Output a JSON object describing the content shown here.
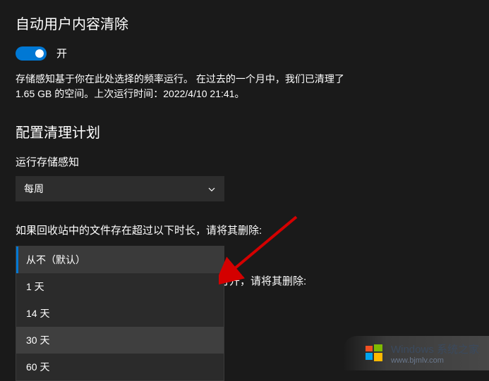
{
  "section": {
    "auto_cleanup_title": "自动用户内容清除",
    "toggle_state_label": "开",
    "description": "存储感知基于你在此处选择的频率运行。 在过去的一个月中，我们已清理了 1.65 GB 的空间。上次运行时间：2022/4/10 21:41。",
    "config_title": "配置清理计划"
  },
  "storage_sense": {
    "label": "运行存储感知",
    "selected": "每周"
  },
  "recycle": {
    "label": "如果回收站中的文件存在超过以下时长，请将其删除:",
    "options": [
      "从不（默认）",
      "1 天",
      "14 天",
      "30 天",
      "60 天"
    ],
    "selected_index": 0,
    "hover_index": 3
  },
  "downloads": {
    "partial_label": "打开，请将其删除:"
  },
  "watermark": {
    "title": "Windows 系统之家",
    "url": "www.bjmlv.com"
  }
}
